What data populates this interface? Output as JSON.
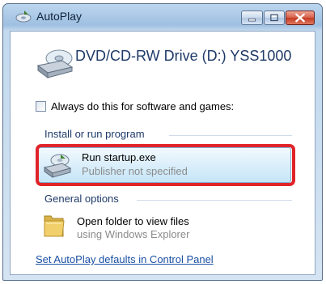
{
  "window": {
    "title": "AutoPlay",
    "buttons": {
      "minimize": "minimize",
      "maximize": "maximize",
      "close": "close"
    }
  },
  "drive": {
    "title": "DVD/CD-RW Drive (D:) YSS1000",
    "icon": "optical-drive-icon"
  },
  "always_checkbox": {
    "label": "Always do this for software and games:",
    "checked": false
  },
  "install_group": {
    "heading": "Install or run program",
    "options": [
      {
        "title": "Run startup.exe",
        "subtitle": "Publisher not specified",
        "icon": "installer-icon",
        "highlighted": true
      }
    ]
  },
  "general_group": {
    "heading": "General options",
    "options": [
      {
        "title": "Open folder to view files",
        "subtitle": "using Windows Explorer",
        "icon": "folder-icon"
      }
    ]
  },
  "footer_link": "Set AutoPlay defaults in Control Panel",
  "colors": {
    "highlight_border": "#e0242a",
    "link": "#1a4fa3",
    "heading": "#1e3a68"
  }
}
